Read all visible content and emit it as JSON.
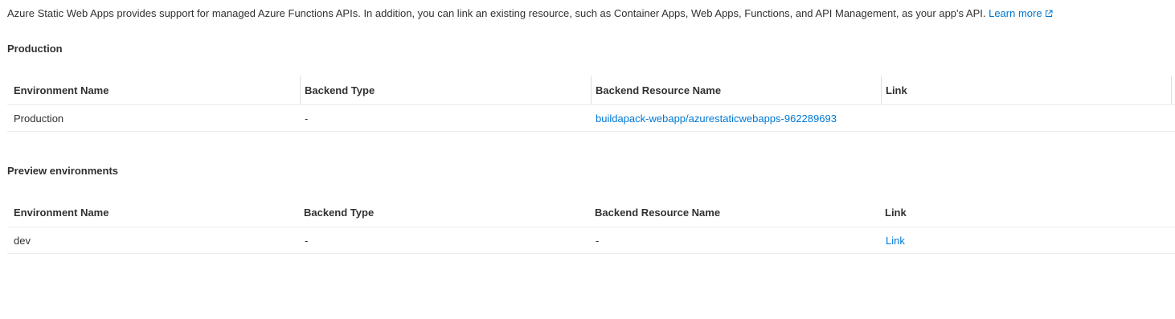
{
  "intro": {
    "text": "Azure Static Web Apps provides support for managed Azure Functions APIs. In addition, you can link an existing resource, such as Container Apps, Web Apps, Functions, and API Management, as your app's API.",
    "learn_more_label": "Learn more",
    "learn_more_icon": "external-link-icon"
  },
  "production": {
    "title": "Production",
    "columns": [
      "Environment Name",
      "Backend Type",
      "Backend Resource Name",
      "Link"
    ],
    "rows": [
      {
        "environment_name": "Production",
        "backend_type": "-",
        "backend_resource_name": "buildapack-webapp/azurestaticwebapps-962289693",
        "link": ""
      }
    ]
  },
  "preview": {
    "title": "Preview environments",
    "columns": [
      "Environment Name",
      "Backend Type",
      "Backend Resource Name",
      "Link"
    ],
    "rows": [
      {
        "environment_name": "dev",
        "backend_type": "-",
        "backend_resource_name": "-",
        "link": "Link"
      }
    ]
  },
  "colors": {
    "link": "#0078d4",
    "text": "#323130",
    "divider": "#edebe9"
  }
}
